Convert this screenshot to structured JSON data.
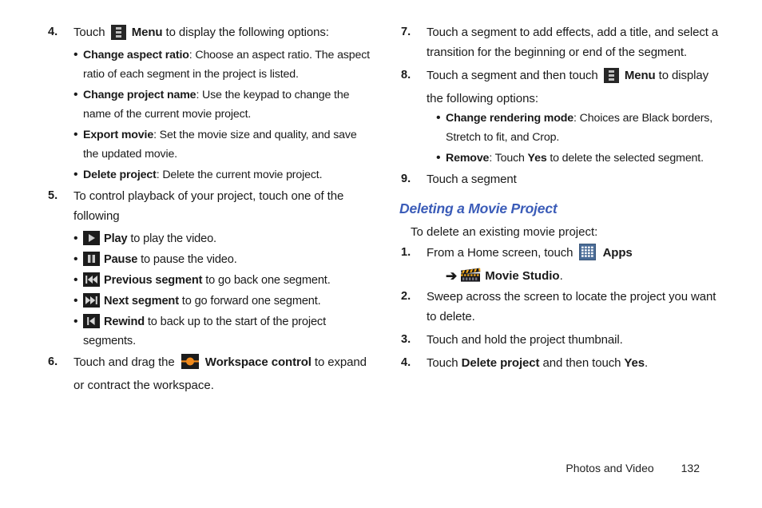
{
  "document": {
    "footer": {
      "section_title": "Photos and Video",
      "page_number": "132"
    },
    "colors": {
      "heading_blue": "#3b5cb8",
      "icon_dark": "#1c1c1c",
      "icon_orange": "#f08a1c",
      "apps_blue": "#4a6c97"
    }
  },
  "left_column": {
    "step4": {
      "number": "4.",
      "text_before_icon": "Touch ",
      "icon": "menu-icon",
      "bold_label": "Menu",
      "text_after": " to display the following options:"
    },
    "step4_bullets": [
      {
        "dot": "•",
        "bold": "Change aspect ratio",
        "rest": ": Choose an aspect ratio. The aspect ratio of each segment in the project is listed."
      },
      {
        "dot": "•",
        "bold": "Change project name",
        "rest": ": Use the keypad to change the name of the current movie project."
      },
      {
        "dot": "•",
        "bold": "Export movie",
        "rest": ": Set the movie size and quality, and save the updated movie."
      },
      {
        "dot": "•",
        "bold": "Delete project",
        "rest": ": Delete the current movie project."
      }
    ],
    "step5": {
      "number": "5.",
      "text": "To control playback of your project, touch one of the following"
    },
    "step5_bullets": [
      {
        "dot": "•",
        "icon": "play-icon",
        "bold": "Play",
        "rest": " to play the video."
      },
      {
        "dot": "•",
        "icon": "pause-icon",
        "bold": "Pause",
        "rest": " to pause the video."
      },
      {
        "dot": "•",
        "icon": "previous-segment-icon",
        "bold": "Previous segment",
        "rest": " to go back one segment."
      },
      {
        "dot": "•",
        "icon": "next-segment-icon",
        "bold": "Next segment",
        "rest": " to go forward one segment."
      },
      {
        "dot": "•",
        "icon": "rewind-icon",
        "bold": "Rewind",
        "rest": " to back up to the start of the project segments."
      }
    ],
    "step6": {
      "number": "6.",
      "text_before_icon": "Touch and drag the ",
      "icon": "workspace-control-icon",
      "bold_label": "Workspace control",
      "text_after": " to expand",
      "line2": "or contract the workspace."
    }
  },
  "right_column": {
    "step7": {
      "number": "7.",
      "text": "Touch a segment to add effects, add a title, and select a transition for the beginning or end of the segment."
    },
    "step8": {
      "number": "8.",
      "text_before_icon": "Touch a segment and then touch ",
      "icon": "menu-icon",
      "bold_label": "Menu",
      "text_after": " to display",
      "line2": "the following options:"
    },
    "step8_bullets": [
      {
        "dot": "•",
        "bold": "Change rendering mode",
        "rest": ": Choices are Black borders, Stretch to fit, and Crop."
      },
      {
        "dot": "•",
        "bold": "Remove",
        "rest_1": ": Touch ",
        "bold_2": "Yes",
        "rest_2": " to delete the selected segment."
      }
    ],
    "step9": {
      "number": "9.",
      "text": "Touch a segment"
    },
    "heading": "Deleting a Movie Project",
    "intro": "To delete an existing movie project:",
    "steps": [
      {
        "number": "1.",
        "text_before_icon": "From a Home screen, touch ",
        "icon": "apps-icon",
        "bold_label": "Apps",
        "arrow": "➔",
        "icon2": "movie-studio-icon",
        "bold_label2": "Movie Studio",
        "text_after": "."
      },
      {
        "number": "2.",
        "text": "Sweep across the screen to locate the project you want to delete."
      },
      {
        "number": "3.",
        "text": "Touch and hold the project thumbnail."
      },
      {
        "number": "4.",
        "text_before": "Touch ",
        "bold_1": "Delete project",
        "middle": " and then touch ",
        "bold_2": "Yes",
        "text_after": "."
      }
    ]
  }
}
